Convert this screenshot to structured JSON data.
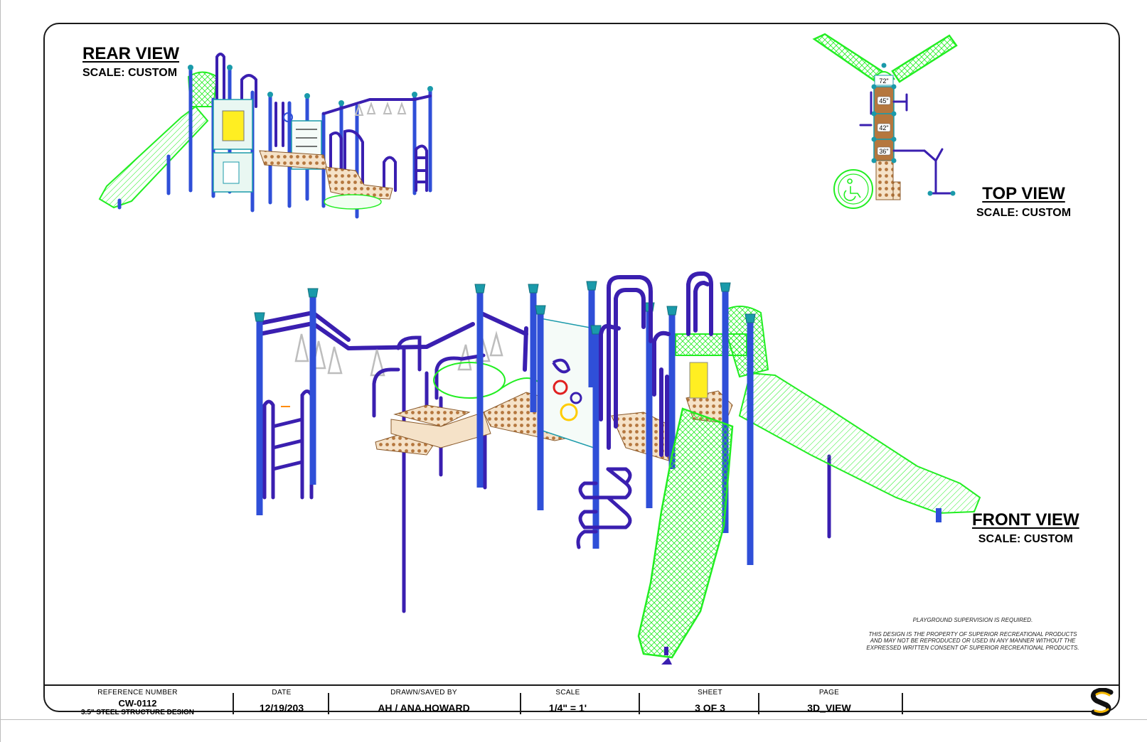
{
  "views": {
    "rear": {
      "name": "REAR VIEW",
      "scale": "SCALE: CUSTOM"
    },
    "top": {
      "name": "TOP VIEW",
      "scale": "SCALE: CUSTOM"
    },
    "front": {
      "name": "FRONT VIEW",
      "scale": "SCALE: CUSTOM"
    }
  },
  "deck_heights": [
    "72\"",
    "45\"",
    "42\"",
    "36\""
  ],
  "notice": {
    "supervision": "PLAYGROUND SUPERVISION IS REQUIRED.",
    "property": "THIS DESIGN IS THE PROPERTY OF SUPERIOR RECREATIONAL PRODUCTS AND MAY NOT BE REPRODUCED OR USED IN ANY MANNER WITHOUT THE EXPRESSED WRITTEN CONSENT OF SUPERIOR RECREATIONAL PRODUCTS."
  },
  "title_block": {
    "reference": {
      "label": "REFERENCE NUMBER",
      "value": "CW-0112",
      "subtitle": "3.5\" STEEL STRUCTURE DESIGN"
    },
    "date": {
      "label": "DATE",
      "value": "12/19/203"
    },
    "drawn_by": {
      "label": "DRAWN/SAVED BY",
      "value": "AH / ANA.HOWARD"
    },
    "scale": {
      "label": "SCALE",
      "value": "1/4\" = 1'"
    },
    "sheet": {
      "label": "SHEET",
      "value": "3 OF 3"
    },
    "page": {
      "label": "PAGE",
      "value": "3D_VIEW"
    }
  },
  "colors": {
    "post": "#2f4fd8",
    "rail": "#3a1fb0",
    "cap": "#1a9aaa",
    "slide": "#22ee22",
    "deck": "#b5773e",
    "panel": "#e9f7f2",
    "handhold": "#ffee22"
  }
}
